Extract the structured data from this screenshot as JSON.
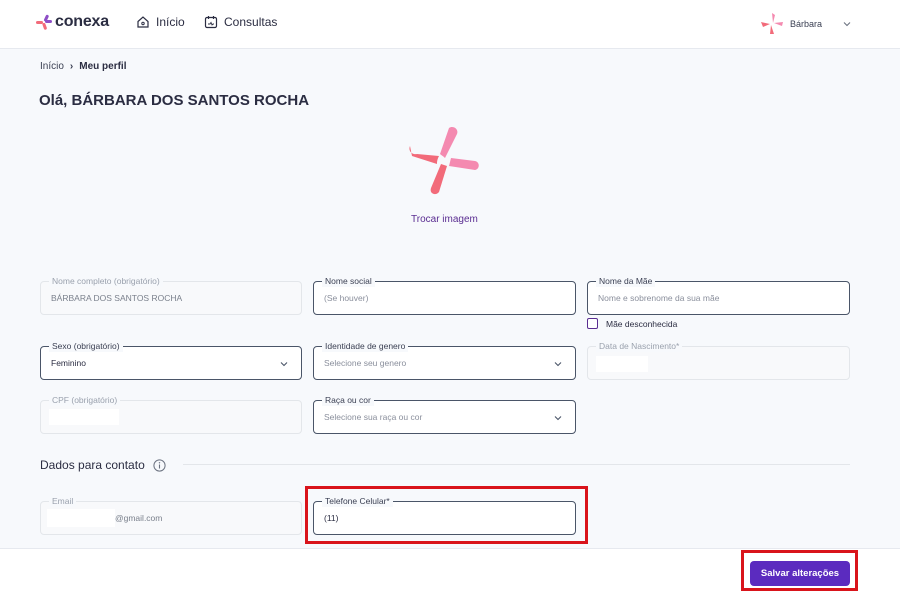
{
  "header": {
    "logo_text": "conexa",
    "nav": [
      {
        "label": "Início",
        "icon": "home-icon"
      },
      {
        "label": "Consultas",
        "icon": "calendar-icon"
      }
    ],
    "user_name": "Bárbara"
  },
  "breadcrumb": {
    "home": "Início",
    "separator": "›",
    "current": "Meu perfil"
  },
  "page_title": "Olá, BÁRBARA DOS SANTOS ROCHA",
  "profile": {
    "change_image_label": "Trocar imagem"
  },
  "form": {
    "full_name": {
      "label": "Nome completo (obrigatório)",
      "value": "BÁRBARA DOS SANTOS ROCHA"
    },
    "social_name": {
      "label": "Nome social",
      "placeholder": "(Se houver)"
    },
    "mother_name": {
      "label": "Nome da Mãe",
      "placeholder": "Nome e sobrenome da sua mãe"
    },
    "mother_unknown": {
      "label": "Mãe desconhecida",
      "checked": false
    },
    "sex": {
      "label": "Sexo (obrigatório)",
      "value": "Feminino"
    },
    "gender_identity": {
      "label": "Identidade de genero",
      "placeholder": "Selecione seu genero"
    },
    "birth_date": {
      "label": "Data de Nascimento*"
    },
    "cpf": {
      "label": "CPF (obrigatório)"
    },
    "race": {
      "label": "Raça ou cor",
      "placeholder": "Selecione sua raça ou cor"
    }
  },
  "contact": {
    "section_title": "Dados para contato",
    "email": {
      "label": "Email",
      "value": "@gmail.com"
    },
    "phone": {
      "label": "Telefone Celular*",
      "value": "(11)"
    }
  },
  "footer": {
    "save_label": "Salvar alterações"
  },
  "colors": {
    "brand_purple": "#5b2bbf",
    "brand_pink": "#f26b7a",
    "highlight_red": "#d9141b"
  }
}
